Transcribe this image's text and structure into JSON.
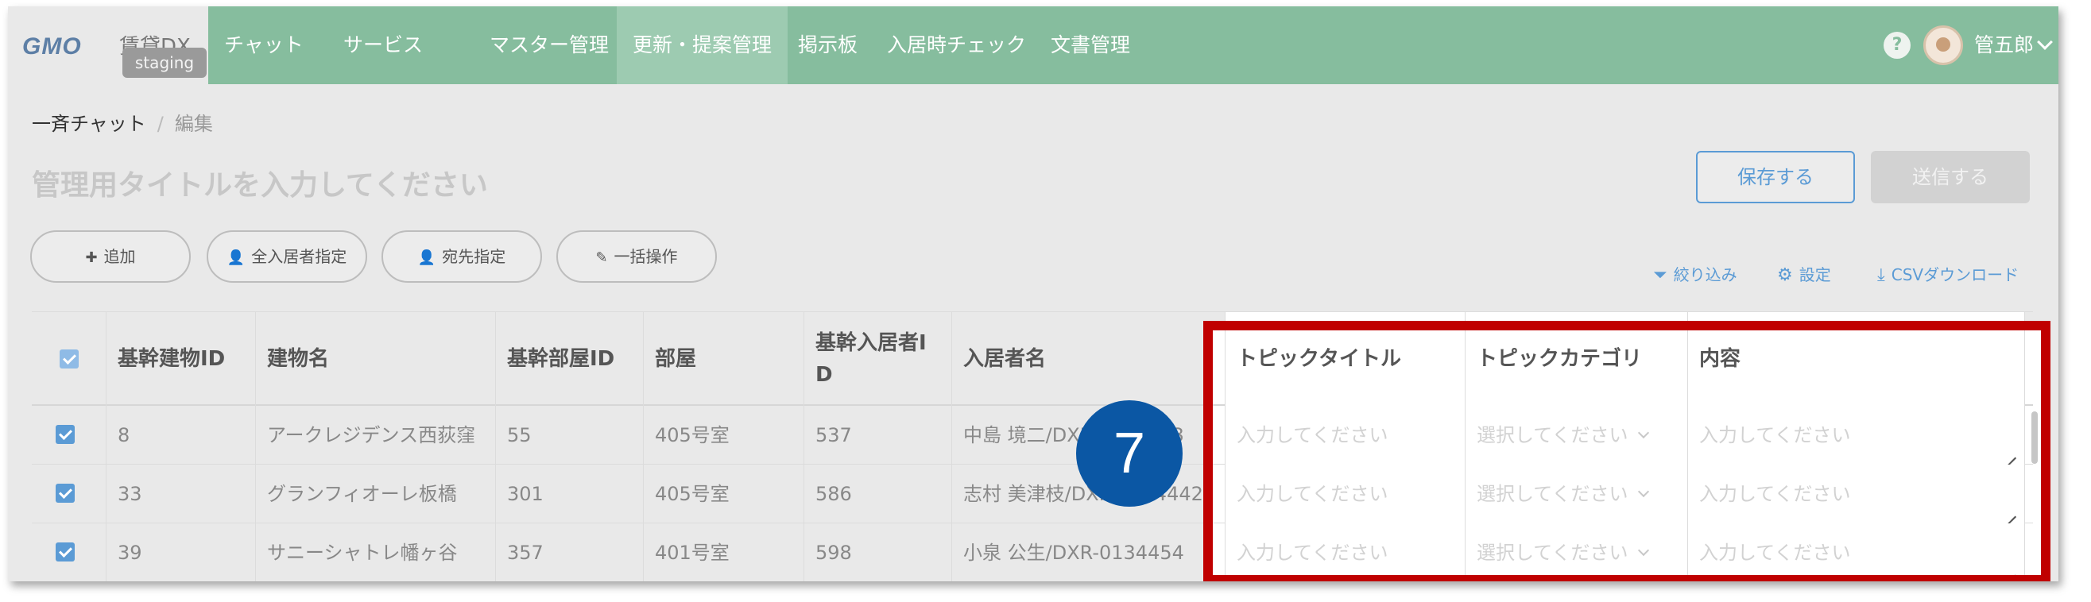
{
  "brand": {
    "logo": "GMO",
    "product": "賃貸DX",
    "env_badge": "staging"
  },
  "nav": [
    {
      "label": "チャット",
      "active": false
    },
    {
      "label": "サービス",
      "active": false
    },
    {
      "label": "マスター管理",
      "active": false
    },
    {
      "label": "更新・提案管理",
      "active": true
    },
    {
      "label": "掲示板",
      "active": false
    },
    {
      "label": "入居時チェック",
      "active": false
    },
    {
      "label": "文書管理",
      "active": false
    }
  ],
  "user": {
    "help": "?",
    "name": "管五郎"
  },
  "breadcrumb": {
    "parent": "一斉チャット",
    "separator": "/",
    "current": "編集"
  },
  "page": {
    "title_placeholder": "管理用タイトルを入力してください"
  },
  "buttons": {
    "save": "保存する",
    "send": "送信する"
  },
  "actions": [
    {
      "label": "追加",
      "icon": "plus-icon"
    },
    {
      "label": "全入居者指定",
      "icon": "user-icon"
    },
    {
      "label": "宛先指定",
      "icon": "user-check-icon"
    },
    {
      "label": "一括操作",
      "icon": "pencil-icon"
    }
  ],
  "tools": [
    {
      "label": "絞り込み",
      "icon": "filter-icon"
    },
    {
      "label": "設定",
      "icon": "gear-icon"
    },
    {
      "label": "CSVダウンロード",
      "icon": "download-icon"
    }
  ],
  "table": {
    "columns": [
      "基幹建物ID",
      "建物名",
      "基幹部屋ID",
      "部屋",
      "基幹入居者ID",
      "入居者名",
      "トピックタイトル",
      "トピックカテゴリ",
      "内容"
    ],
    "rows": [
      {
        "building_id": "8",
        "building": "アークレジデンス西荻窪",
        "room_id": "55",
        "room": "405号室",
        "resident_id": "537",
        "resident": "中島 境二/DXR-0134453",
        "topic_title": "入力してください",
        "topic_category": "選択してください",
        "content": "入力してください"
      },
      {
        "building_id": "33",
        "building": "グランフィオーレ板橋",
        "room_id": "301",
        "room": "405号室",
        "resident_id": "586",
        "resident": "志村 美津枝/DXR-0134442",
        "topic_title": "入力してください",
        "topic_category": "選択してください",
        "content": "入力してください"
      },
      {
        "building_id": "39",
        "building": "サニーシャトレ幡ヶ谷",
        "room_id": "357",
        "room": "401号室",
        "resident_id": "598",
        "resident": "小泉 公生/DXR-0134454",
        "topic_title": "入力してください",
        "topic_category": "選択してください",
        "content": "入力してください"
      }
    ]
  },
  "annotation": {
    "step": "7"
  },
  "colors": {
    "header": "#86bd9e",
    "accent": "#5b9bd5",
    "highlight": "#c00000",
    "badge": "#0b57a4"
  }
}
